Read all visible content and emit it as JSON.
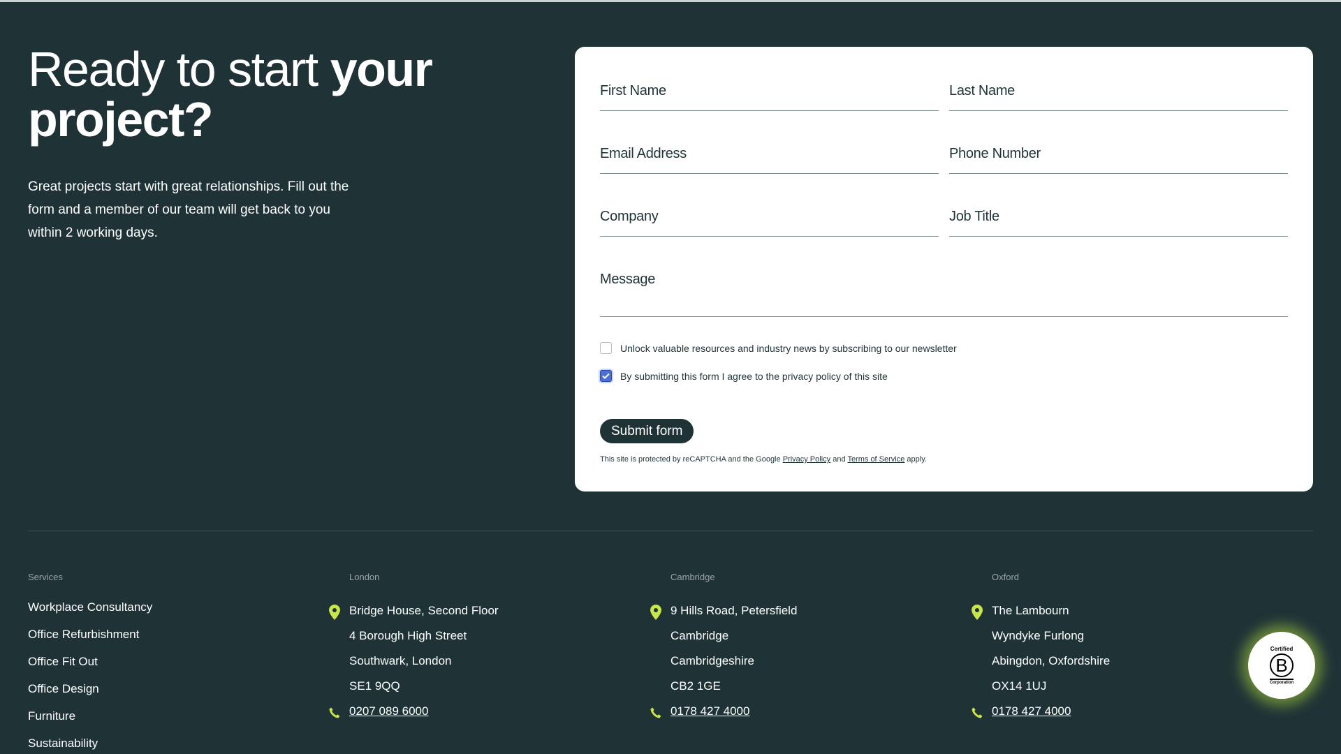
{
  "hero": {
    "title_light": "Ready to start ",
    "title_bold_1": "your",
    "title_bold_2": "project?",
    "text": "Great projects start with great relationships. Fill out the form and a member of our team will get back to you within 2 working days."
  },
  "form": {
    "first_name": "First Name",
    "last_name": "Last Name",
    "email": "Email Address",
    "phone": "Phone Number",
    "company": "Company",
    "job_title": "Job Title",
    "message": "Message",
    "newsletter_label": "Unlock valuable resources and industry news by subscribing to our newsletter",
    "newsletter_checked": false,
    "privacy_label": "By submitting this form I agree to the privacy policy of this site",
    "privacy_checked": true,
    "submit_label": "Submit form",
    "recaptcha_prefix": "This site is protected by reCAPTCHA and the Google ",
    "privacy_policy_link": "Privacy Policy",
    "recaptcha_and": " and ",
    "terms_link": "Terms of Service",
    "recaptcha_suffix": " apply."
  },
  "footer": {
    "services": {
      "heading": "Services",
      "items": [
        "Workplace Consultancy",
        "Office Refurbishment",
        "Office Fit Out",
        "Office Design",
        "Furniture",
        "Sustainability"
      ]
    },
    "london": {
      "heading": "London",
      "lines": [
        "Bridge House, Second Floor",
        "4 Borough High Street",
        "Southwark, London",
        "SE1 9QQ"
      ],
      "phone": "0207 089 6000"
    },
    "cambridge": {
      "heading": "Cambridge",
      "lines": [
        "9 Hills Road, Petersfield",
        "Cambridge",
        "Cambridgeshire",
        "CB2 1GE"
      ],
      "phone": "0178 427 4000"
    },
    "oxford": {
      "heading": "Oxford",
      "lines": [
        "The Lambourn",
        "Wyndyke Furlong",
        "Abingdon, Oxfordshire",
        "OX14 1UJ"
      ],
      "phone": "0178 427 4000"
    },
    "icon_color": "#c8e64a"
  },
  "badge": {
    "top": "Certified",
    "letter": "B",
    "bottom": "Corporation"
  }
}
